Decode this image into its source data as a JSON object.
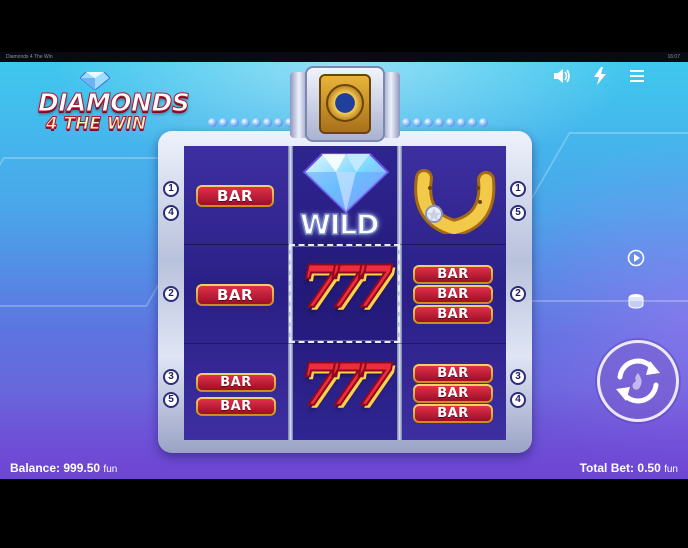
{
  "window": {
    "title": "Diamonds 4 The Win",
    "clock": "16:07"
  },
  "logo": {
    "line1": "DIAMONDS",
    "line2": "4 THE WIN"
  },
  "controls": {
    "sound_icon": "speaker-icon",
    "turbo_icon": "lightning-icon",
    "menu_icon": "hamburger-menu-icon",
    "autoplay_icon": "autoplay-icon",
    "bet_icon": "coin-stack-icon",
    "spin_icon": "spin-arrows-icon"
  },
  "reels": {
    "bar_label": "BAR",
    "wild_label": "WILD",
    "seven_label": "777",
    "grid": [
      [
        "bar-1",
        "diamond-wild",
        "horseshoe"
      ],
      [
        "bar-1",
        "seven-777",
        "bar-3"
      ],
      [
        "bar-2",
        "seven-777",
        "bar-3"
      ]
    ]
  },
  "paylines": {
    "left": [
      "1",
      "4",
      "2",
      "3",
      "5"
    ],
    "right": [
      "1",
      "5",
      "2",
      "3",
      "4"
    ]
  },
  "footer": {
    "balance_label": "Balance:",
    "balance_value": "999.50",
    "balance_unit": "fun",
    "bet_label": "Total Bet:",
    "bet_value": "0.50",
    "bet_unit": "fun"
  },
  "colors": {
    "bar_red": "#d0223c",
    "bar_gold": "#e6b43e",
    "reel_bg": "#2a1f86",
    "sky_top": "#3fc8ee",
    "sky_bottom": "#7a52d6"
  }
}
